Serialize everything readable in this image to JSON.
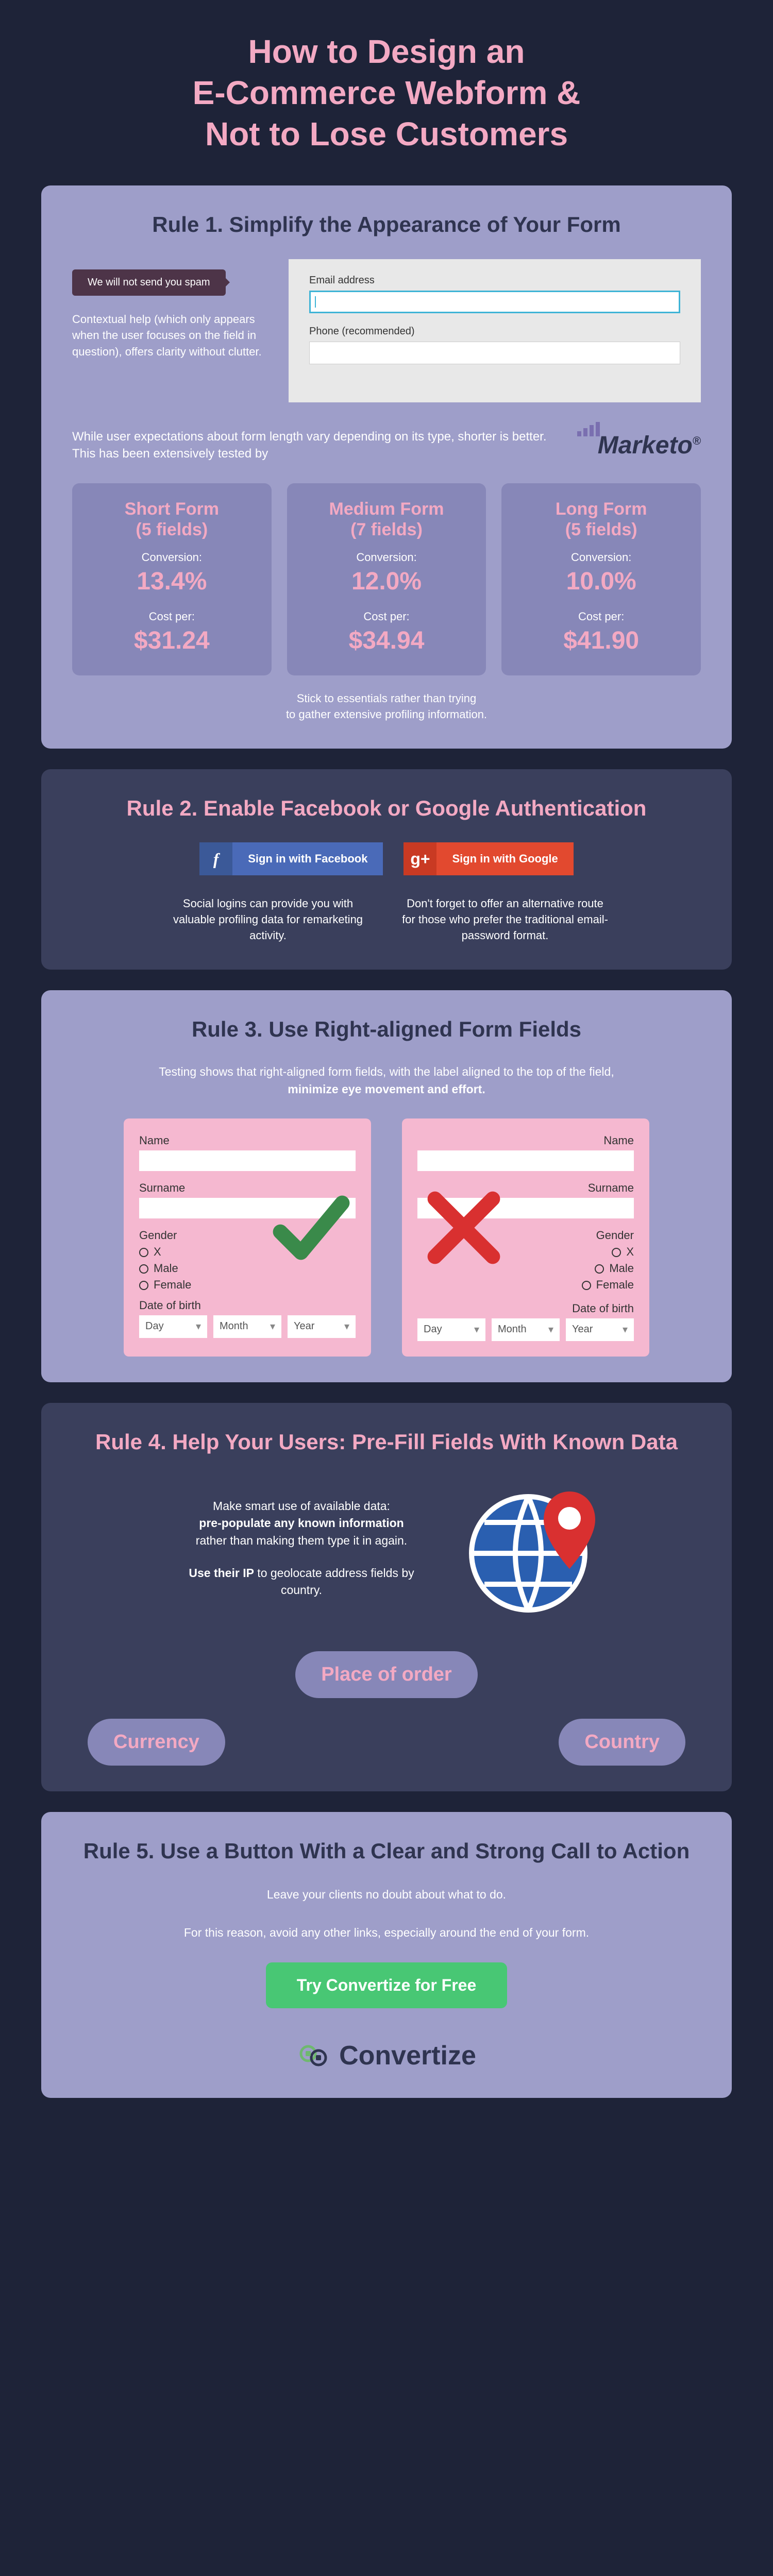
{
  "title": "How to Design an\nE-Commerce Webform &\nNot to Lose Customers",
  "rule1": {
    "heading": "Rule 1. Simplify the Appearance of Your Form",
    "spam_notice": "We will not send you spam",
    "help_text": "Contextual help (which only appears when the user focuses on the field in question), offers clarity without clutter.",
    "email_label": "Email address",
    "phone_label": "Phone (recommended)",
    "marketo_text": "While user expectations about form length vary depending on its type, shorter is better. This has been extensively tested by",
    "marketo_name": "Marketo",
    "stats": [
      {
        "title": "Short Form\n(5 fields)",
        "conv_label": "Conversion:",
        "conv": "13.4%",
        "cost_label": "Cost per:",
        "cost": "$31.24"
      },
      {
        "title": "Medium Form\n(7 fields)",
        "conv_label": "Conversion:",
        "conv": "12.0%",
        "cost_label": "Cost per:",
        "cost": "$34.94"
      },
      {
        "title": "Long Form\n(5 fields)",
        "conv_label": "Conversion:",
        "conv": "10.0%",
        "cost_label": "Cost per:",
        "cost": "$41.90"
      }
    ],
    "stick": "Stick to essentials rather than trying\nto gather extensive profiling information."
  },
  "rule2": {
    "heading": "Rule 2. Enable Facebook or Google Authentication",
    "fb_label": "Sign in with Facebook",
    "gg_label": "Sign in with Google",
    "gg_icon": "g+",
    "fb_icon": "f",
    "note1": "Social logins can provide you with valuable profiling data for remarketing activity.",
    "note2": "Don't forget to offer an alternative route for those who prefer the traditional email-password format."
  },
  "rule3": {
    "heading": "Rule 3. Use Right-aligned Form Fields",
    "desc_1": "Testing shows that right-aligned form fields, with the label aligned to the top of the field,",
    "desc_2": "minimize eye movement and effort.",
    "labels": {
      "name": "Name",
      "surname": "Surname",
      "gender": "Gender",
      "opt_x": "X",
      "opt_m": "Male",
      "opt_f": "Female",
      "dob": "Date of birth",
      "day": "Day",
      "month": "Month",
      "year": "Year"
    }
  },
  "rule4": {
    "heading": "Rule 4. Help Your Users: Pre-Fill Fields With Known Data",
    "text1a": "Make smart use of available data:",
    "text1b": "pre-populate any known information",
    "text1c": "rather than making them type it in again.",
    "text2a": "Use their IP",
    "text2b": " to geolocate address fields by country.",
    "pills": {
      "place": "Place of order",
      "currency": "Currency",
      "country": "Country"
    }
  },
  "rule5": {
    "heading": "Rule 5. Use a Button With a Clear and Strong Call to Action",
    "line1": "Leave your clients no doubt about what to do.",
    "line2": "For this reason, avoid any other links, especially around the end of your form.",
    "cta": "Try Convertize for Free",
    "brand": "Convertize"
  }
}
